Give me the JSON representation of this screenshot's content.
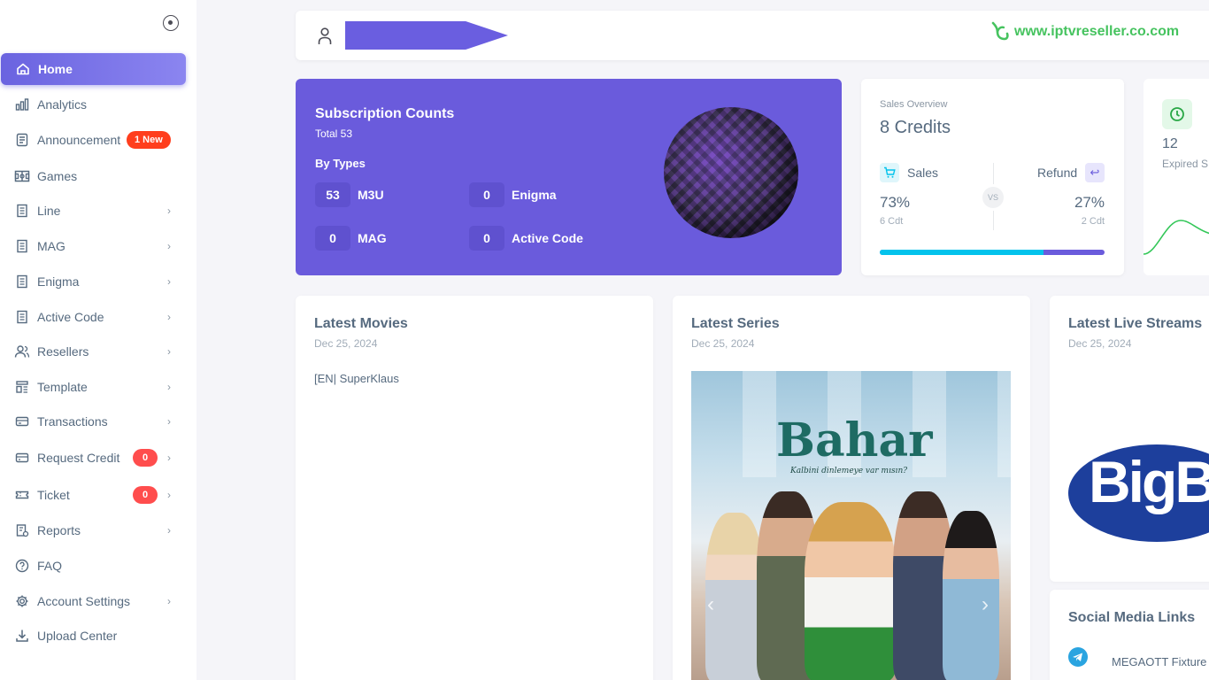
{
  "sidebar": {
    "items": [
      {
        "label": "Home",
        "icon": "home-icon"
      },
      {
        "label": "Analytics",
        "icon": "bar-chart-icon"
      },
      {
        "label": "Announcement",
        "icon": "document-icon",
        "badge": "1 New"
      },
      {
        "label": "Games",
        "icon": "football-field-icon"
      },
      {
        "label": "Line",
        "icon": "file-list-icon"
      },
      {
        "label": "MAG",
        "icon": "file-list-icon"
      },
      {
        "label": "Enigma",
        "icon": "file-list-icon"
      },
      {
        "label": "Active Code",
        "icon": "file-list-icon"
      },
      {
        "label": "Resellers",
        "icon": "users-icon"
      },
      {
        "label": "Template",
        "icon": "template-icon"
      },
      {
        "label": "Transactions",
        "icon": "wallet-icon"
      },
      {
        "label": "Request Credit",
        "icon": "credit-card-icon",
        "badge": "0"
      },
      {
        "label": "Ticket",
        "icon": "ticket-icon",
        "badge": "0"
      },
      {
        "label": "Reports",
        "icon": "report-icon"
      },
      {
        "label": "FAQ",
        "icon": "question-icon"
      },
      {
        "label": "Account Settings",
        "icon": "gear-icon"
      },
      {
        "label": "Upload Center",
        "icon": "download-icon"
      }
    ]
  },
  "header": {
    "brand": "www.iptvreseller.co.com"
  },
  "subscription": {
    "title": "Subscription Counts",
    "total": "Total 53",
    "by_types": "By Types",
    "types": [
      {
        "count": "53",
        "label": "M3U"
      },
      {
        "count": "0",
        "label": "Enigma"
      },
      {
        "count": "0",
        "label": "MAG"
      },
      {
        "count": "0",
        "label": "Active Code"
      }
    ]
  },
  "sales": {
    "label": "Sales Overview",
    "credits": "8 Credits",
    "sales_label": "Sales",
    "refund_label": "Refund",
    "vs": "VS",
    "sales_pct": "73%",
    "refund_pct": "27%",
    "sales_cdt": "6 Cdt",
    "refund_cdt": "2 Cdt",
    "sales_fraction": 0.73,
    "colors": {
      "sales": "#03c3ec",
      "refund": "#6a5bdc"
    }
  },
  "expired": {
    "count": "12",
    "label": "Expired S"
  },
  "movies": {
    "title": "Latest Movies",
    "date": "Dec 25, 2024",
    "image_alt": "[EN| SuperKlaus"
  },
  "series": {
    "title": "Latest Series",
    "date": "Dec 25, 2024",
    "poster_title": "Bahar",
    "poster_subtitle": "Kalbini dinlemeye var mısın?"
  },
  "live": {
    "title": "Latest Live Streams",
    "date": "Dec 25, 2024",
    "logo_text": "BigB"
  },
  "social": {
    "title": "Social Media Links",
    "items": [
      {
        "text": "MEGAOTT Fixture",
        "icon": "telegram-icon"
      }
    ]
  }
}
